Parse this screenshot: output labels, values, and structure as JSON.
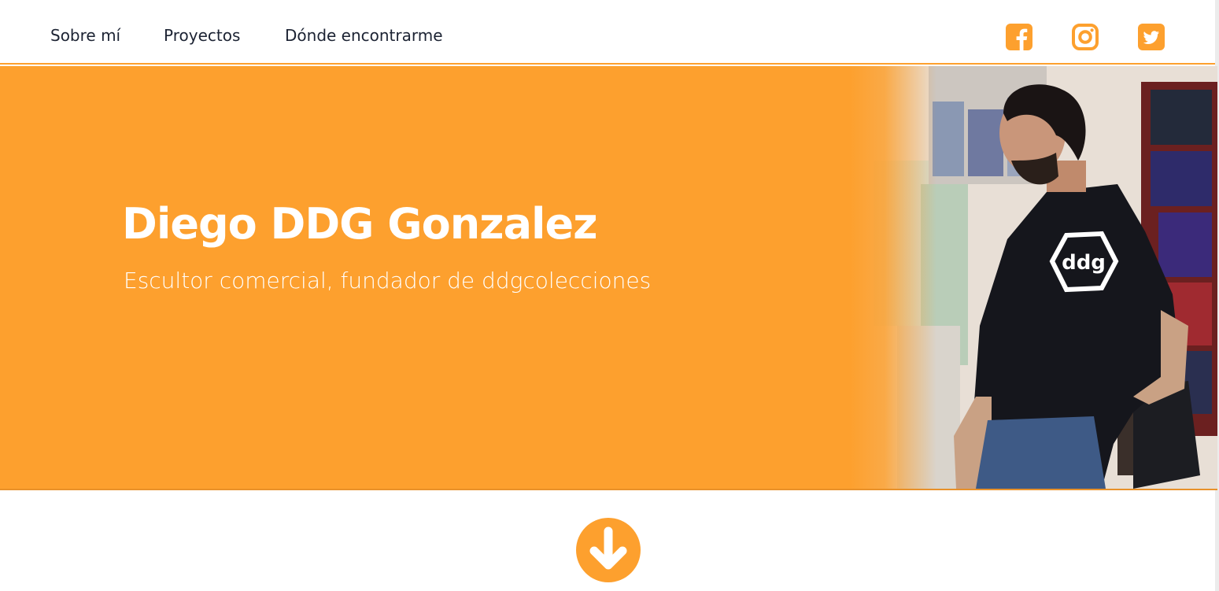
{
  "nav": {
    "links": [
      {
        "label": "Sobre mí"
      },
      {
        "label": "Proyectos"
      },
      {
        "label": "Dónde encontrarme"
      }
    ],
    "social_icons": [
      "facebook-icon",
      "instagram-icon",
      "twitter-icon"
    ]
  },
  "hero": {
    "title": "Diego DDG Gonzalez",
    "subtitle": "Escultor comercial, fundador de ddgcolecciones",
    "shirt_logo": "ddg"
  },
  "scroll_icon": "arrow-down-circle-icon",
  "colors": {
    "accent": "#fda02e",
    "nav_text": "#1c2333",
    "hero_text": "#ffffff",
    "shirt": "#15161c"
  }
}
